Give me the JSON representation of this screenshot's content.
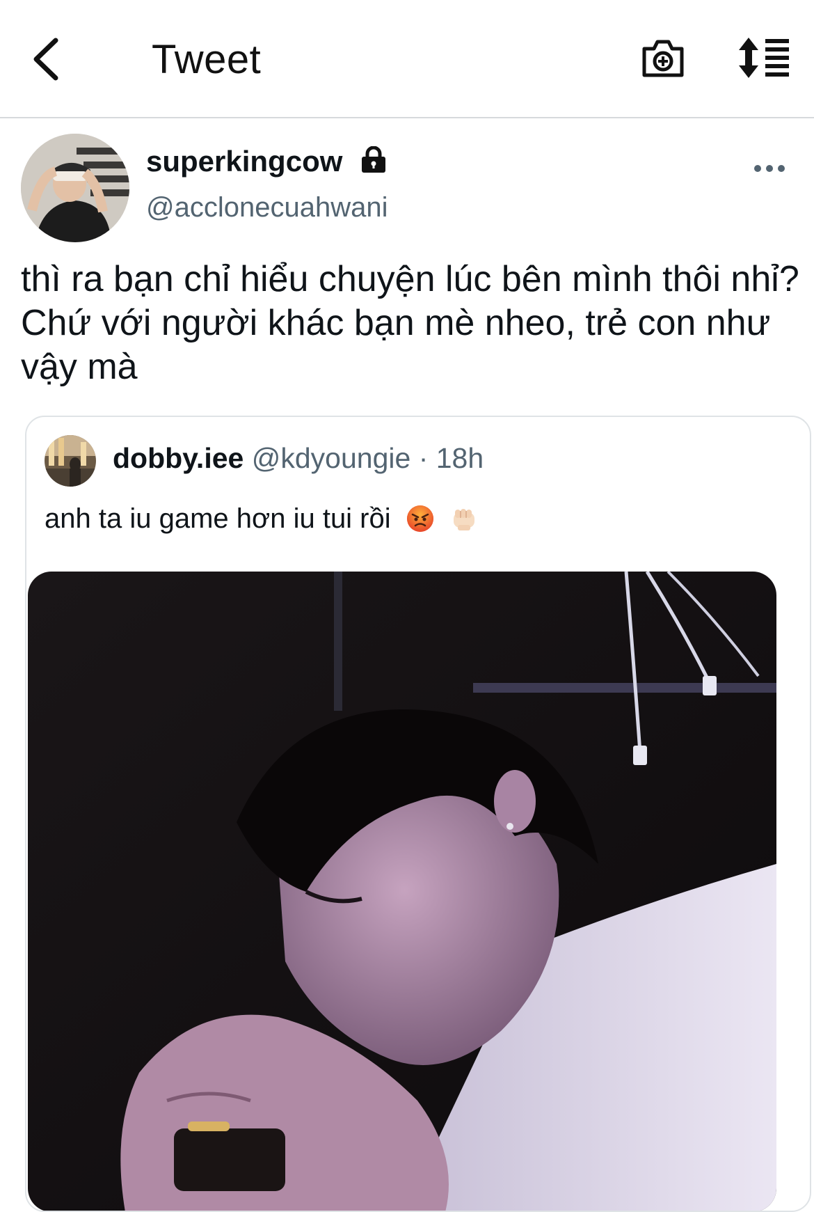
{
  "header": {
    "title": "Tweet",
    "back_icon": "chevron-left-icon",
    "camera_icon": "camera-plus-icon",
    "sort_icon": "sort-list-icon"
  },
  "tweet": {
    "author_name": "superkingcow",
    "author_handle": "@acclonecuahwani",
    "protected_icon": "lock-icon",
    "more_icon": "more-horizontal-icon",
    "text": "thì ra bạn chỉ hiểu chuyện lúc bên mình thôi nhỉ? Chứ với người khác bạn mè nheo, trẻ con như vậy mà"
  },
  "quote": {
    "author_name": "dobby.iee",
    "author_handle": "@kdyoungie",
    "separator": "·",
    "time": "18h",
    "text": "anh ta iu game hơn iu tui rồi",
    "emojis": [
      "angry-face-emoji",
      "fist-emoji"
    ]
  },
  "colors": {
    "text": "#0f1419",
    "secondary": "#536471",
    "border": "#dfe3e6"
  }
}
